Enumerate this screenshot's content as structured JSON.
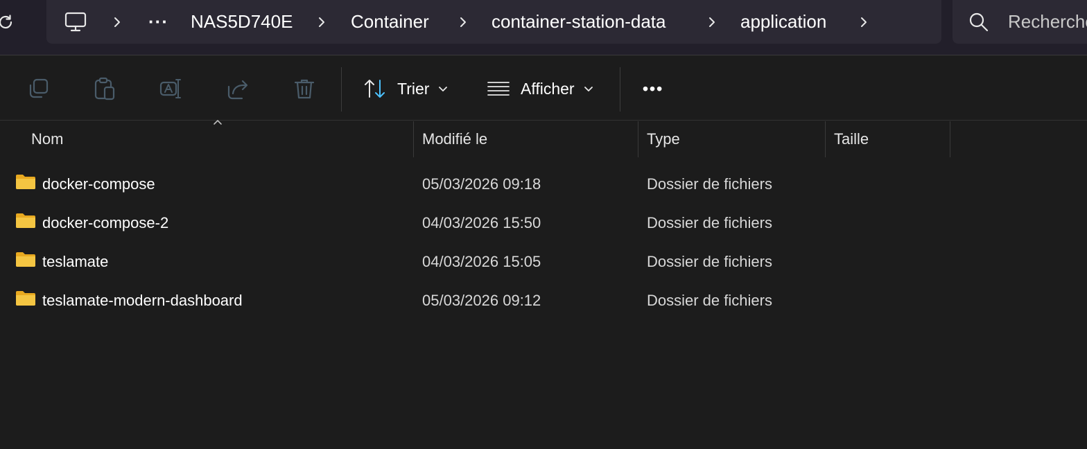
{
  "address_bar": {
    "breadcrumbs": [
      "NAS5D740E",
      "Container",
      "container-station-data",
      "application"
    ],
    "overflow_label": "···",
    "icons": [
      "refresh-icon",
      "this-pc-icon",
      "chevron-right-icon",
      "more-horizontal-icon"
    ]
  },
  "search": {
    "placeholder": "Recherche",
    "icon": "search-icon"
  },
  "toolbar": {
    "icons": [
      "copy-icon",
      "paste-icon",
      "rename-icon",
      "share-icon",
      "delete-icon"
    ],
    "sort_label": "Trier",
    "view_label": "Afficher",
    "more_label": "•••",
    "accent_color": "#4cc2ff"
  },
  "columns": {
    "name": "Nom",
    "modified": "Modifié le",
    "type": "Type",
    "size": "Taille"
  },
  "rows": [
    {
      "name": "docker-compose",
      "modified": "05/03/2026 09:18",
      "type": "Dossier de fichiers",
      "size": ""
    },
    {
      "name": "docker-compose-2",
      "modified": "04/03/2026 15:50",
      "type": "Dossier de fichiers",
      "size": ""
    },
    {
      "name": "teslamate",
      "modified": "04/03/2026 15:05",
      "type": "Dossier de fichiers",
      "size": ""
    },
    {
      "name": "teslamate-modern-dashboard",
      "modified": "05/03/2026 09:12",
      "type": "Dossier de fichiers",
      "size": ""
    }
  ],
  "colors": {
    "background": "#1c1c1c",
    "header_bar": "#221f2a",
    "folder": "#f4c542"
  }
}
